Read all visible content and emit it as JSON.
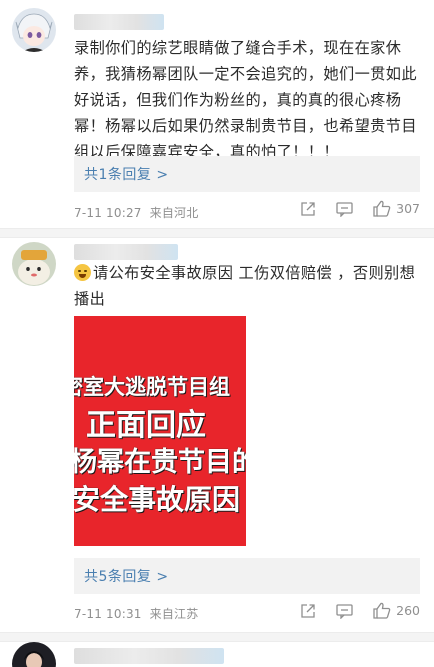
{
  "comments": [
    {
      "body": "录制你们的综艺眼睛做了缝合手术，现在在家休养，我猜杨幂团队一定不会追究的，她们一贯如此好说话，但我们作为粉丝的，真的真的很心疼杨幂！杨幂以后如果仍然录制贵节目，也希望贵节目组以后保障嘉宾安全，真的怕了！！！",
      "reply_link": "共1条回复 >",
      "time": "7-11 10:27",
      "location": "来自河北",
      "likes": "307"
    },
    {
      "body": "请公布安全事故原因 工伤双倍赔偿 ，否则别想播出",
      "emoji": "grinning-sweat-emoji",
      "poster_lines": [
        "密室大逃脱节目组",
        "正面回应",
        "杨幂在贵节目的",
        "安全事故原因"
      ],
      "reply_link": "共5条回复 >",
      "time": "7-11 10:31",
      "location": "来自江苏",
      "likes": "260"
    }
  ],
  "icons": [
    "share-icon",
    "comment-icon",
    "like-icon"
  ],
  "colors": {
    "link": "#4a7fb0",
    "reply_bg": "#f2f2f2",
    "poster_red": "#e8252b",
    "meta": "#8f8f8f"
  }
}
